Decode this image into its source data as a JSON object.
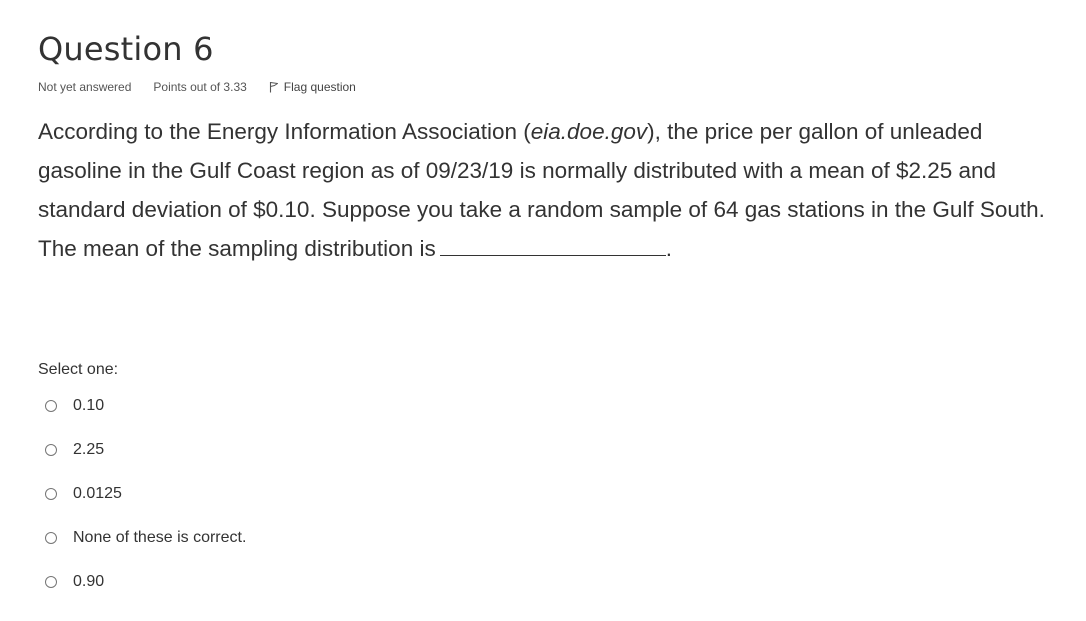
{
  "question": {
    "title": "Question 6",
    "state": "Not yet answered",
    "grade": "Points out of 3.33",
    "flag_label": "Flag question",
    "text_part1": "According to the Energy Information Association (",
    "text_italic": "eia.doe.gov",
    "text_part2": "), the price per gallon of unleaded gasoline in the Gulf Coast region as of 09/23/19 is normally distributed with a mean of $2.25 and standard deviation of $0.10.  Suppose you take a random sample of 64 gas stations in the Gulf South.  The mean of the sampling distribution is",
    "text_end": "."
  },
  "answer": {
    "prompt": "Select one:",
    "options": [
      {
        "label": "0.10"
      },
      {
        "label": "2.25"
      },
      {
        "label": "0.0125"
      },
      {
        "label": "None of these is correct."
      },
      {
        "label": "0.90"
      }
    ]
  },
  "icons": {
    "flag": "flag-icon",
    "radio": "radio-unchecked-icon"
  },
  "colors": {
    "text": "#333333",
    "meta_text": "#555555",
    "radio_border": "#767676"
  }
}
